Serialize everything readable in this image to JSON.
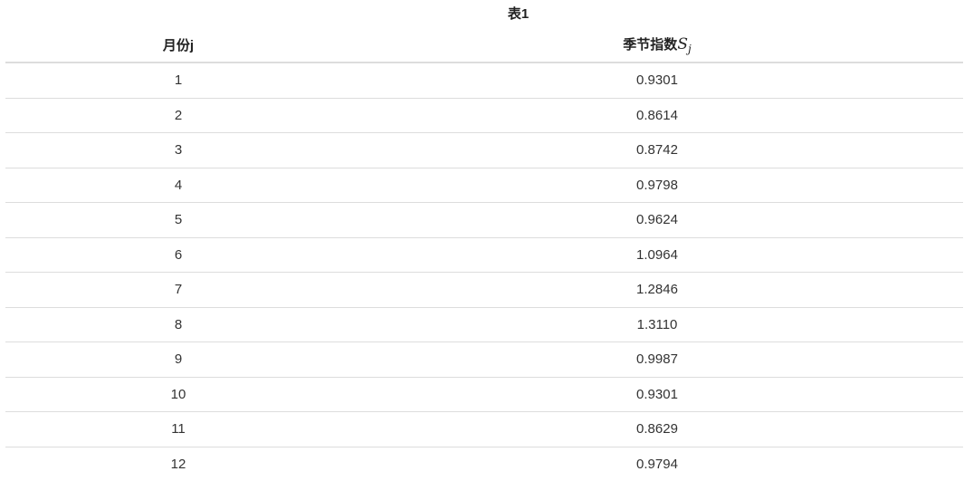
{
  "table": {
    "caption": "表1",
    "headers": {
      "month": "月份j",
      "index_prefix": "季节指数",
      "index_symbol": "S",
      "index_subscript": "j"
    },
    "rows": [
      {
        "month": "1",
        "index": "0.9301"
      },
      {
        "month": "2",
        "index": "0.8614"
      },
      {
        "month": "3",
        "index": "0.8742"
      },
      {
        "month": "4",
        "index": "0.9798"
      },
      {
        "month": "5",
        "index": "0.9624"
      },
      {
        "month": "6",
        "index": "1.0964"
      },
      {
        "month": "7",
        "index": "1.2846"
      },
      {
        "month": "8",
        "index": "1.3110"
      },
      {
        "month": "9",
        "index": "0.9987"
      },
      {
        "month": "10",
        "index": "0.9301"
      },
      {
        "month": "11",
        "index": "0.8629"
      },
      {
        "month": "12",
        "index": "0.9794"
      }
    ]
  }
}
